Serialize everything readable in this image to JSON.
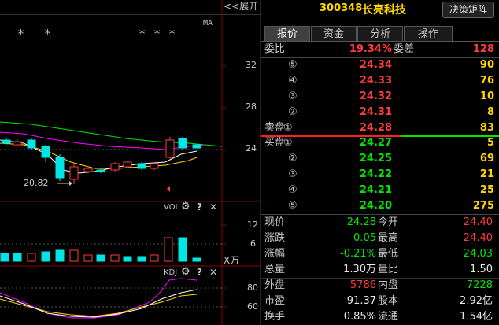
{
  "chart": {
    "expand_label": "<<展开",
    "ma_label": "MA",
    "stars": "* * * * *",
    "price_axis": [
      "32",
      "28",
      "24"
    ],
    "low_marker": "20.82",
    "vol_label": "VOL",
    "vol_axis": [
      "12",
      "6"
    ],
    "vol_unit": "X万",
    "kdj_label": "KDJ",
    "kdj_axis": [
      "80",
      "60"
    ],
    "gear_icon": "gear-icon",
    "help_icon": "question-icon",
    "close_icon": "close-icon"
  },
  "header": {
    "code": "300348",
    "name": "长亮科技",
    "decision_button": "决策矩阵"
  },
  "tabs": [
    "报价",
    "资金",
    "分析",
    "操作"
  ],
  "quote": {
    "weibi_label": "委比",
    "weibi": "19.34%",
    "weicha_label": "委差",
    "weicha": "128",
    "asks": [
      {
        "label": "5",
        "price": "24.34",
        "vol": "90"
      },
      {
        "label": "4",
        "price": "24.33",
        "vol": "76"
      },
      {
        "label": "3",
        "price": "24.32",
        "vol": "10"
      },
      {
        "label": "2",
        "price": "24.31",
        "vol": "8"
      },
      {
        "label": "1",
        "price": "24.28",
        "vol": "83"
      }
    ],
    "sell_label": "卖盘",
    "buy_label": "买盘",
    "bids": [
      {
        "label": "1",
        "price": "24.27",
        "vol": "5"
      },
      {
        "label": "2",
        "price": "24.25",
        "vol": "69"
      },
      {
        "label": "3",
        "price": "24.22",
        "vol": "21"
      },
      {
        "label": "4",
        "price": "24.21",
        "vol": "25"
      },
      {
        "label": "5",
        "price": "24.20",
        "vol": "275"
      }
    ],
    "stats": {
      "xianjia_label": "现价",
      "xianjia": "24.28",
      "jinkai_label": "今开",
      "jinkai": "24.40",
      "zhangdie_label": "涨跌",
      "zhangdie": "-0.05",
      "zuigao_label": "最高",
      "zuigao": "24.40",
      "zhangfu_label": "涨幅",
      "zhangfu": "-0.21%",
      "zuidi_label": "最低",
      "zuidi": "24.03",
      "zongliang_label": "总量",
      "zongliang": "1.30万",
      "liangbi_label": "量比",
      "liangbi": "1.50",
      "waipan_label": "外盘",
      "waipan": "5786",
      "neipan_label": "内盘",
      "neipan": "7228",
      "shiying_label": "市盈",
      "shiying": "91.37",
      "guben_label": "股本",
      "guben": "2.92亿",
      "huanshou_label": "换手",
      "huanshou": "0.85%",
      "liutong_label": "流通",
      "liutong": "1.54亿"
    }
  },
  "colors": {
    "up": "#ff3b3b",
    "down": "#00e6e6",
    "ma5": "#ffffff",
    "ma10": "#ffd700",
    "ma20": "#ff00ff",
    "ma60": "#00e600"
  }
}
